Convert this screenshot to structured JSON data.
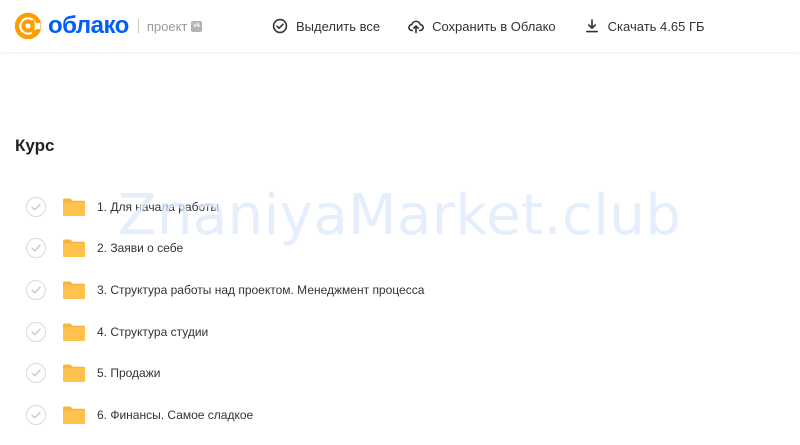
{
  "header": {
    "logo_text": "облако",
    "project_label": "проект",
    "vk_badge": "vk",
    "actions": {
      "select_all": "Выделить все",
      "save_to_cloud": "Сохранить в Облако",
      "download": "Скачать 4.65 ГБ"
    }
  },
  "folder": {
    "title": "Курс",
    "items": [
      {
        "label": "1. Для начала работы"
      },
      {
        "label": "2. Заяви о себе"
      },
      {
        "label": "3. Структура работы над проектом. Менеджмент процесса"
      },
      {
        "label": "4. Структура студии"
      },
      {
        "label": "5. Продажи"
      },
      {
        "label": "6. Финансы. Самое сладкое"
      }
    ]
  },
  "watermark": "ZnaniyaMarket.club",
  "colors": {
    "brand_blue": "#005ff9",
    "logo_orange": "#ff9e00",
    "folder_yellow": "#ffc34d",
    "folder_tab": "#f5b53f"
  },
  "icons": {
    "logo": "at-sign-logo-icon",
    "select_all": "check-circle-icon",
    "save": "cloud-upload-icon",
    "download": "download-icon",
    "row_check": "checkmark-icon",
    "folder": "folder-icon"
  }
}
